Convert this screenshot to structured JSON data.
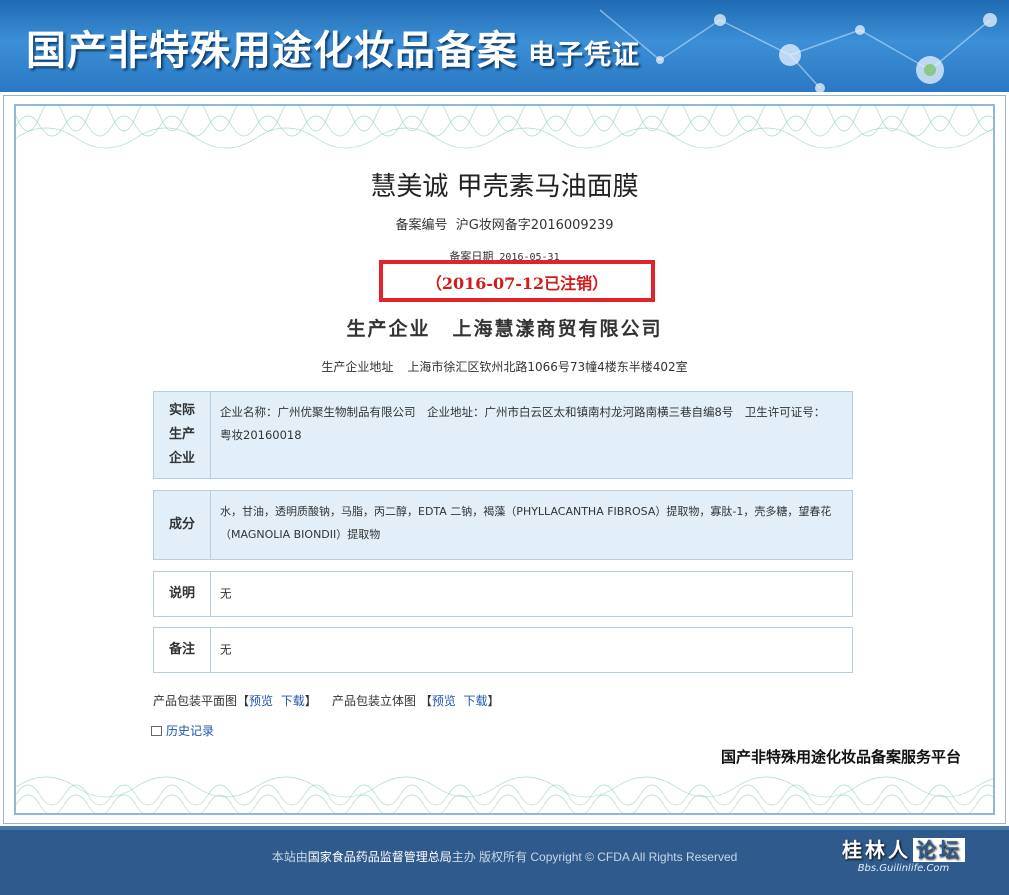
{
  "header": {
    "title": "国产非特殊用途化妆品备案",
    "subtitle": "电子凭证"
  },
  "record": {
    "product_name": "慧美诚 甲壳素马油面膜",
    "reg_no_label": "备案编号",
    "reg_no": "沪G妆网备字2016009239",
    "reg_date_label": "备案日期",
    "reg_date": "2016-05-31",
    "cancel_notice": "（2016-07-12已注销）",
    "company_label": "生产企业",
    "company": "上海慧漾商贸有限公司",
    "address_label": "生产企业地址",
    "address": "上海市徐汇区钦州北路1066号73幢4楼东半楼402室"
  },
  "rows": {
    "actual_company": {
      "label": "实际\n生产\n企业",
      "text": "企业名称：广州优聚生物制品有限公司　企业地址：广州市白云区太和镇南村龙河路南横三巷自编8号　卫生许可证号：粤妆20160018"
    },
    "ingredients": {
      "label": "成分",
      "text": "水，甘油，透明质酸钠，马脂，丙二醇，EDTA 二钠，褐藻（PHYLLACANTHA FIBROSA）提取物，寡肽-1，壳多糖，望春花（MAGNOLIA BIONDII）提取物"
    },
    "description": {
      "label": "说明",
      "text": "无"
    },
    "remarks": {
      "label": "备注",
      "text": "无"
    }
  },
  "packaging": {
    "flat_label": "产品包装平面图",
    "solid_label": "产品包装立体图",
    "preview": "预览",
    "download": "下载"
  },
  "history_link": "历史记录",
  "platform": "国产非特殊用途化妆品备案服务平台",
  "footer": {
    "prefix": "本站由",
    "org": "国家食品药品监督管理总局",
    "suffix": "主办 版权所有 Copyright © CFDA All Rights Reserved"
  },
  "watermark": {
    "name_main": "桂林人",
    "name_box": "论坛",
    "url": "Bbs.Guilinlife.Com"
  },
  "colors": {
    "banner": "#2b78c4",
    "cancel_red": "#e3232c",
    "row_blue": "#e3eff8",
    "footer": "#2e5b8c"
  }
}
